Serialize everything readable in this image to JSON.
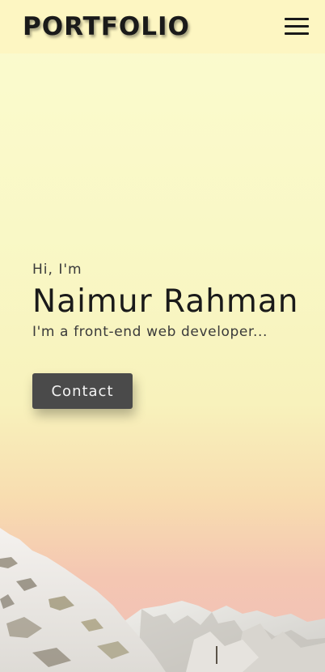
{
  "header": {
    "brand": "PORTFOLIO",
    "menu_icon": "hamburger-menu-icon"
  },
  "hero": {
    "greeting": "Hi, I'm",
    "name": "Naimur Rahman",
    "tagline": "I'm a front-end web developer...",
    "contact_label": "Contact"
  },
  "colors": {
    "header_bg": "#fdf6c2",
    "button_bg": "#4a4a4a",
    "text": "#1a1a1a"
  }
}
